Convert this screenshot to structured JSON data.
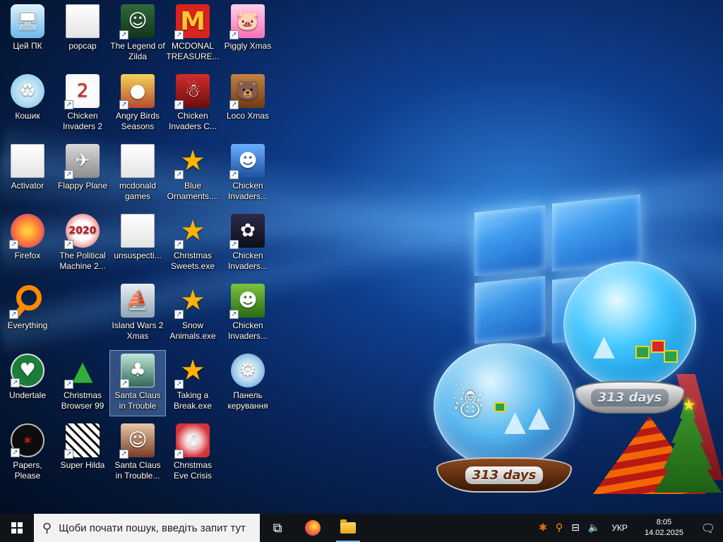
{
  "desktop": {
    "icons": [
      {
        "label": "Цей ПК",
        "icon": "this-pc-icon",
        "glyph": "🖥",
        "shortcut": false
      },
      {
        "label": "popcap",
        "icon": "folder-icon",
        "glyph": "",
        "shortcut": false
      },
      {
        "label": "The Legend of Zilda",
        "icon": "zilda-game-icon",
        "glyph": "☺",
        "shortcut": true
      },
      {
        "label": "MCDONAL TREASURE...",
        "icon": "mcdonalds-icon",
        "glyph": "M",
        "shortcut": true
      },
      {
        "label": "Piggly Xmas",
        "icon": "piggly-xmas-icon",
        "glyph": "🐷",
        "shortcut": true
      },
      {
        "label": "Кошик",
        "icon": "recycle-bin-icon",
        "glyph": "♻",
        "shortcut": false
      },
      {
        "label": "Chicken Invaders 2",
        "icon": "chicken-invaders-2-icon",
        "glyph": "2",
        "shortcut": true
      },
      {
        "label": "Angry Birds Seasons",
        "icon": "angry-birds-icon",
        "glyph": "●",
        "shortcut": true
      },
      {
        "label": "Chicken Invaders C...",
        "icon": "chicken-invaders-c-icon",
        "glyph": "☃",
        "shortcut": true
      },
      {
        "label": "Loco Xmas",
        "icon": "loco-xmas-icon",
        "glyph": "🐻",
        "shortcut": true
      },
      {
        "label": "Activator",
        "icon": "folder-icon",
        "glyph": "",
        "shortcut": false
      },
      {
        "label": "Flappy Plane",
        "icon": "flappy-plane-icon",
        "glyph": "✈",
        "shortcut": true
      },
      {
        "label": "mcdonald games",
        "icon": "folder-icon",
        "glyph": "",
        "shortcut": false
      },
      {
        "label": "Blue Ornaments....",
        "icon": "star-game-icon",
        "glyph": "★",
        "shortcut": true
      },
      {
        "label": "Chicken Invaders...",
        "icon": "chicken-invaders-icon",
        "glyph": "☻",
        "shortcut": true
      },
      {
        "label": "Firefox",
        "icon": "firefox-icon",
        "glyph": "",
        "shortcut": true
      },
      {
        "label": "The Political Machine 2...",
        "icon": "political-machine-icon",
        "glyph": "2020",
        "shortcut": true
      },
      {
        "label": "unsuspecti...",
        "icon": "folder-icon",
        "glyph": "",
        "shortcut": false
      },
      {
        "label": "Christmas Sweets.exe",
        "icon": "star-game-icon",
        "glyph": "★",
        "shortcut": true
      },
      {
        "label": "Chicken Invaders...",
        "icon": "chicken-invaders-egg-icon",
        "glyph": "✿",
        "shortcut": true
      },
      {
        "label": "Everything",
        "icon": "everything-search-icon",
        "glyph": "",
        "shortcut": true
      },
      {
        "label": "Island Wars 2 Xmas",
        "icon": "island-wars-icon",
        "glyph": "⛵",
        "shortcut": false
      },
      {
        "label": "Snow Animals.exe",
        "icon": "star-game-icon",
        "glyph": "★",
        "shortcut": true
      },
      {
        "label": "Chicken Invaders...",
        "icon": "chicken-invaders-xmas-icon",
        "glyph": "☻",
        "shortcut": true
      },
      {
        "label": "Undertale",
        "icon": "undertale-icon",
        "glyph": "♥",
        "shortcut": true
      },
      {
        "label": "Christmas Browser 99",
        "icon": "christmas-tree-icon",
        "glyph": "▲",
        "shortcut": true
      },
      {
        "label": "Santa Claus in Trouble",
        "icon": "santa-trouble-icon",
        "glyph": "♣",
        "shortcut": true
      },
      {
        "label": "Taking a Break.exe",
        "icon": "star-game-icon",
        "glyph": "★",
        "shortcut": true
      },
      {
        "label": "Панель керування",
        "icon": "control-panel-icon",
        "glyph": "⚙",
        "shortcut": false
      },
      {
        "label": "Papers, Please",
        "icon": "papers-please-icon",
        "glyph": "✶",
        "shortcut": true
      },
      {
        "label": "Super Hilda",
        "icon": "super-hilda-icon",
        "glyph": "",
        "shortcut": true
      },
      {
        "label": "Santa Claus in Trouble... A...",
        "icon": "santa-trouble-again-icon",
        "glyph": "☺",
        "shortcut": true
      },
      {
        "label": "Christmas Eve Crisis",
        "icon": "christmas-eve-crisis-icon",
        "glyph": "☃",
        "shortcut": true
      }
    ],
    "widgets": {
      "globe_left_text": "313 days",
      "globe_right_text": "313 days"
    }
  },
  "taskbar": {
    "search_placeholder": "Щоби почати пошук, введіть запит тут",
    "language": "УКР",
    "time": "8:05",
    "date": "14.02.2025"
  }
}
